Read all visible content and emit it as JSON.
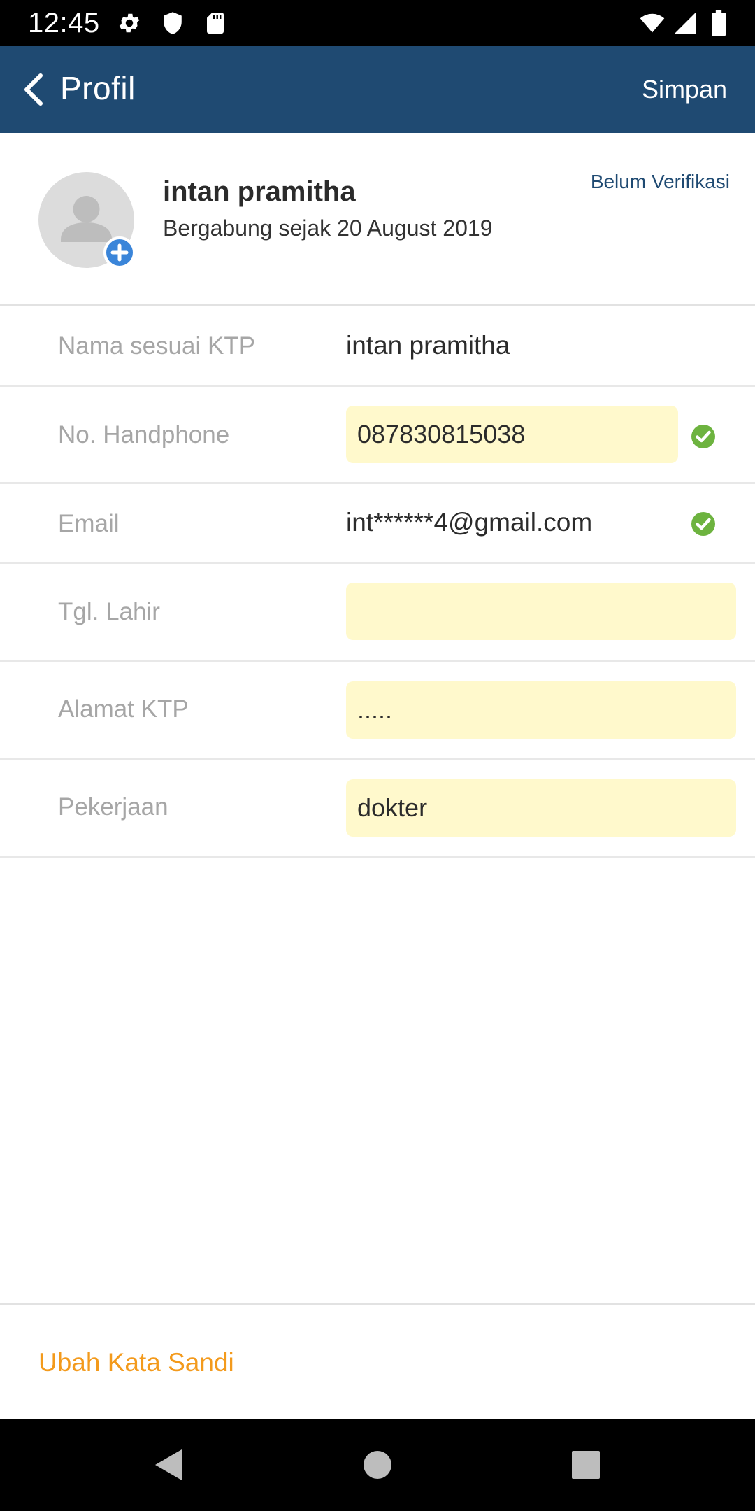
{
  "status_bar": {
    "time": "12:45",
    "left_icons": [
      "gear-icon",
      "shield-icon",
      "sd-card-icon"
    ],
    "right_icons": [
      "wifi-icon",
      "signal-icon",
      "battery-icon"
    ]
  },
  "app_bar": {
    "title": "Profil",
    "save_label": "Simpan",
    "color": "#1f4a72"
  },
  "profile": {
    "name": "intan pramitha",
    "joined": "Bergabung sejak 20 August 2019",
    "verification_status": "Belum Verifikasi"
  },
  "form": {
    "name_label": "Nama sesuai KTP",
    "name_value": "intan pramitha",
    "phone_label": "No. Handphone",
    "phone_value": "087830815038",
    "phone_verified": true,
    "email_label": "Email",
    "email_value": "int******4@gmail.com",
    "email_verified": true,
    "birth_label": "Tgl. Lahir",
    "birth_value": "",
    "address_label": "Alamat KTP",
    "address_value": ".....",
    "job_label": "Pekerjaan",
    "job_value": "dokter",
    "input_bg": "#fff9cc"
  },
  "footer": {
    "change_password_label": "Ubah Kata Sandi",
    "accent": "#f39a1c"
  },
  "nav_bar": {
    "buttons": [
      "back-triangle-icon",
      "home-circle-icon",
      "recents-square-icon"
    ]
  }
}
